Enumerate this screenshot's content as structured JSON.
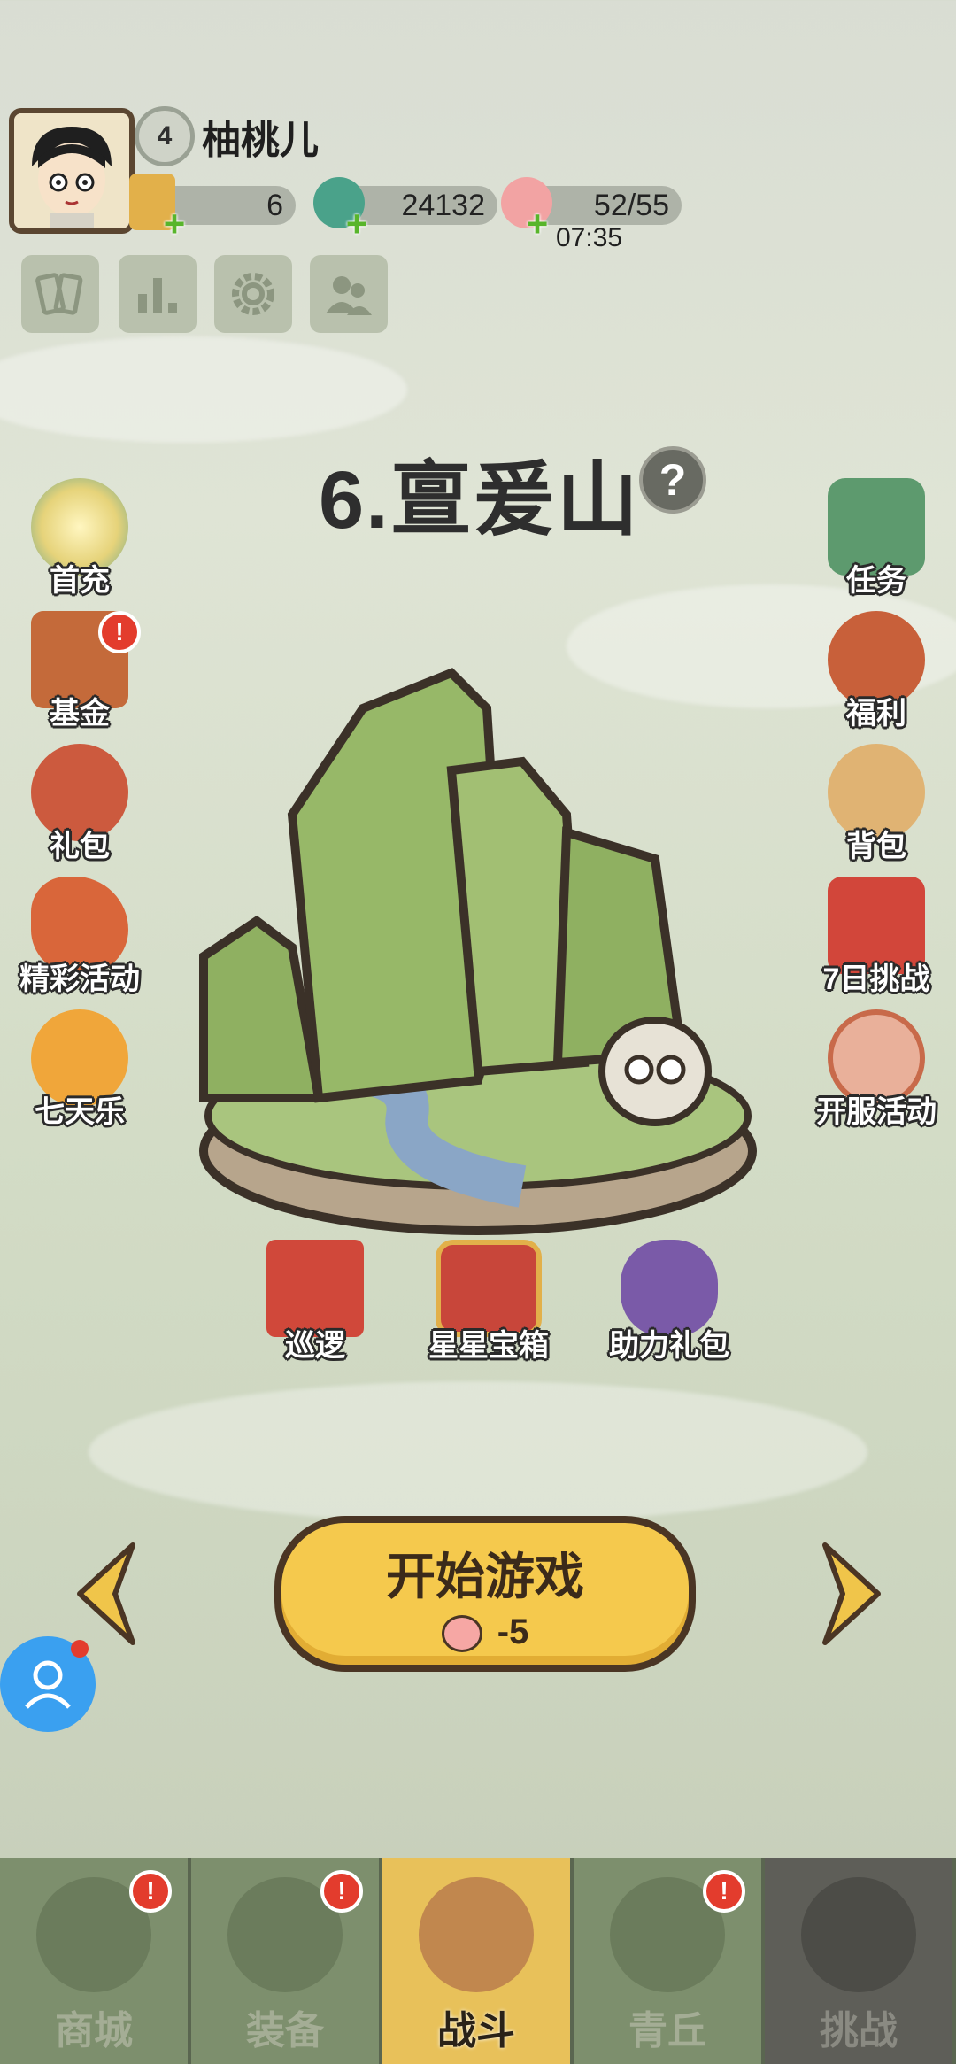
{
  "player": {
    "name": "柚桃儿",
    "level": "4"
  },
  "resources": {
    "tickets": "6",
    "jade": "24132",
    "stamina": "52/55",
    "stamina_timer": "07:35"
  },
  "toolbar": [
    {
      "icon": "cards-icon"
    },
    {
      "icon": "ranking-icon"
    },
    {
      "icon": "settings-gear-icon"
    },
    {
      "icon": "friends-icon"
    }
  ],
  "stage": {
    "title": "6.亶爰山",
    "help": "?"
  },
  "left_menu": [
    {
      "label": "首充",
      "icon": "first-recharge-icon"
    },
    {
      "label": "基金",
      "icon": "fund-icon",
      "badge": "!"
    },
    {
      "label": "礼包",
      "icon": "gift-pack-icon"
    },
    {
      "label": "精彩活动",
      "icon": "events-icon"
    },
    {
      "label": "七天乐",
      "icon": "seven-day-icon"
    }
  ],
  "right_menu": [
    {
      "label": "任务",
      "icon": "tasks-scroll-icon"
    },
    {
      "label": "福利",
      "icon": "welfare-bag-icon"
    },
    {
      "label": "背包",
      "icon": "backpack-icon"
    },
    {
      "label": "7日挑战",
      "icon": "seven-day-challenge-icon"
    },
    {
      "label": "开服活动",
      "icon": "server-open-event-icon"
    }
  ],
  "stage_actions": [
    {
      "label": "巡逻",
      "icon": "patrol-flag-icon"
    },
    {
      "label": "星星宝箱",
      "icon": "star-chest-icon"
    },
    {
      "label": "助力礼包",
      "icon": "boost-gift-bag-icon"
    }
  ],
  "start_button": {
    "label": "开始游戏",
    "cost": "-5"
  },
  "bottom_nav": [
    {
      "label": "商城",
      "badge": "!"
    },
    {
      "label": "装备",
      "badge": "!"
    },
    {
      "label": "战斗",
      "active": true
    },
    {
      "label": "青丘",
      "badge": "!"
    },
    {
      "label": "挑战",
      "locked": true
    }
  ],
  "colors": {
    "accent_yellow": "#f5c94d",
    "badge_red": "#e33c2d",
    "plus_green": "#58b52b"
  }
}
